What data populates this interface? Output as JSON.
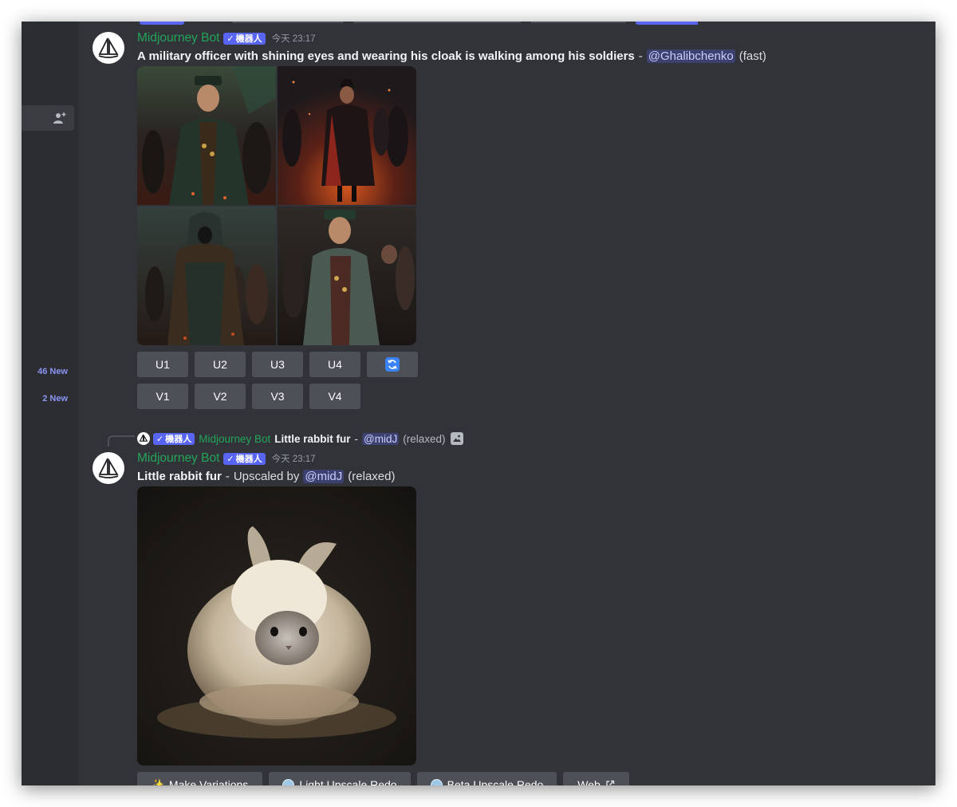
{
  "sidebar": {
    "badges": [
      {
        "label": "46 New"
      },
      {
        "label": "2 New"
      }
    ]
  },
  "message1": {
    "username": "Midjourney Bot",
    "bot_tag": "機器人",
    "timestamp": "今天 23:17",
    "prompt": "A military officer with shining eyes and wearing his cloak is walking among his soldiers",
    "separator": "-",
    "mention": "@Ghalibchenko",
    "mode": "(fast)",
    "upscale_buttons": [
      "U1",
      "U2",
      "U3",
      "U4"
    ],
    "variation_buttons": [
      "V1",
      "V2",
      "V3",
      "V4"
    ]
  },
  "message2": {
    "reply": {
      "bot_tag": "機器人",
      "username": "Midjourney Bot",
      "prompt": "Little rabbit fur",
      "separator": "-",
      "mention": "@midJ",
      "mode": "(relaxed)"
    },
    "username": "Midjourney Bot",
    "bot_tag": "機器人",
    "timestamp": "今天 23:17",
    "prompt": "Little rabbit fur",
    "separator": "-",
    "upscaled_by": "Upscaled by",
    "mention": "@midJ",
    "mode": "(relaxed)",
    "action_buttons": [
      "Make Variations",
      "Light Upscale Redo",
      "Beta Upscale Redo",
      "Web"
    ]
  },
  "colors": {
    "background": "#313338",
    "sidebar": "#2b2d31",
    "bot_green": "#23a55a",
    "blurple": "#5865f2",
    "button": "#4e5058"
  }
}
